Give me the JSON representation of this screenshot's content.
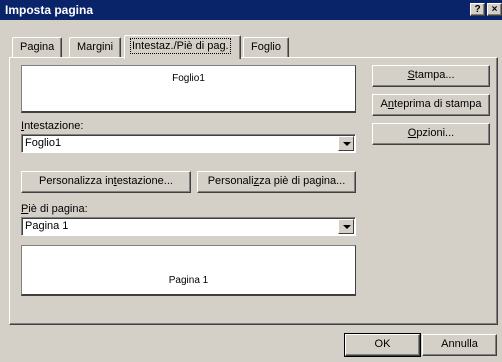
{
  "window": {
    "title": "Imposta pagina",
    "help_glyph": "?",
    "close_glyph": "×"
  },
  "tabs": [
    {
      "label": "Pagina"
    },
    {
      "label": "Margini"
    },
    {
      "label": "Intestaz./Piè di pag.",
      "active": true
    },
    {
      "label": "Foglio"
    }
  ],
  "header": {
    "preview_text": "Foglio1",
    "label_pre": "",
    "label_u": "I",
    "label_post": "ntestazione:",
    "value": "Foglio1",
    "custom_button_pre": "Personalizza in",
    "custom_button_u": "t",
    "custom_button_post": "estazione..."
  },
  "footer": {
    "label_pre": "",
    "label_u": "P",
    "label_post": "iè di pagina:",
    "value": "Pagina 1",
    "preview_text": "Pagina 1",
    "custom_button_pre": "Personali",
    "custom_button_u": "z",
    "custom_button_post": "za piè di pagina..."
  },
  "side_buttons": {
    "print": {
      "pre": "",
      "u": "S",
      "post": "tampa..."
    },
    "preview": {
      "pre": "A",
      "u": "n",
      "post": "teprima di stampa"
    },
    "options": {
      "pre": "",
      "u": "O",
      "post": "pzioni..."
    }
  },
  "dialog_buttons": {
    "ok": "OK",
    "cancel": "Annulla"
  },
  "colors": {
    "titlebar": "#0a246a",
    "face": "#d4d0c8"
  }
}
